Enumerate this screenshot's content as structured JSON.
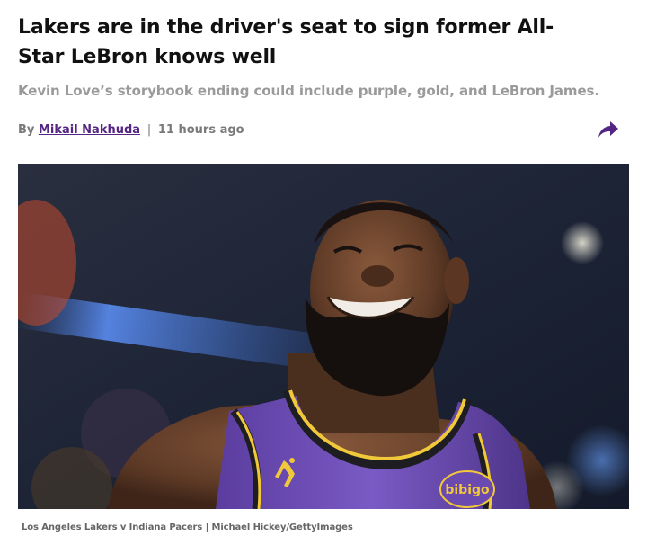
{
  "article": {
    "headline": "Lakers are in the driver's seat to sign former All-Star LeBron knows well",
    "dek": "Kevin Love’s storybook ending could include purple, gold, and LeBron James.",
    "byline": {
      "prefix": "By",
      "author": "Mikail Nakhuda",
      "separator": "|",
      "timestamp": "11 hours ago"
    },
    "share_icon": "share-arrow-icon",
    "accent_color": "#552583",
    "image": {
      "subject": "smiling-basketball-player-photo",
      "jersey_text": "bibigo"
    },
    "caption": "Los Angeles Lakers v Indiana Pacers | Michael Hickey/GettyImages"
  }
}
